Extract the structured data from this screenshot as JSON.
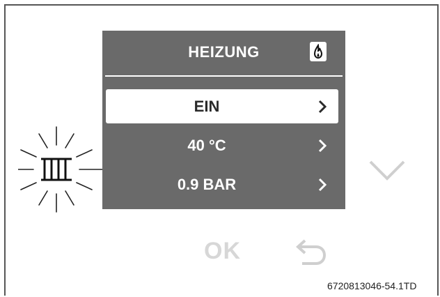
{
  "screen": {
    "title": "HEIZUNG",
    "title_icon": "flame-icon",
    "menu": [
      {
        "label": "EIN",
        "selected": true
      },
      {
        "label": "40 °C",
        "selected": false
      },
      {
        "label": "0.9 BAR",
        "selected": false
      }
    ]
  },
  "controls": {
    "ok_label": "OK",
    "back_icon": "back-arrow-icon",
    "down_icon": "chevron-down-icon",
    "heating_icon": "radiator-flashing-icon"
  },
  "figure_code": "6720813046-54.1TD",
  "colors": {
    "screen_bg": "#6a6a6a",
    "text": "#ffffff",
    "selected_bg": "#ffffff",
    "selected_text": "#2a2a2a",
    "inactive_button": "#d7d7d7"
  }
}
